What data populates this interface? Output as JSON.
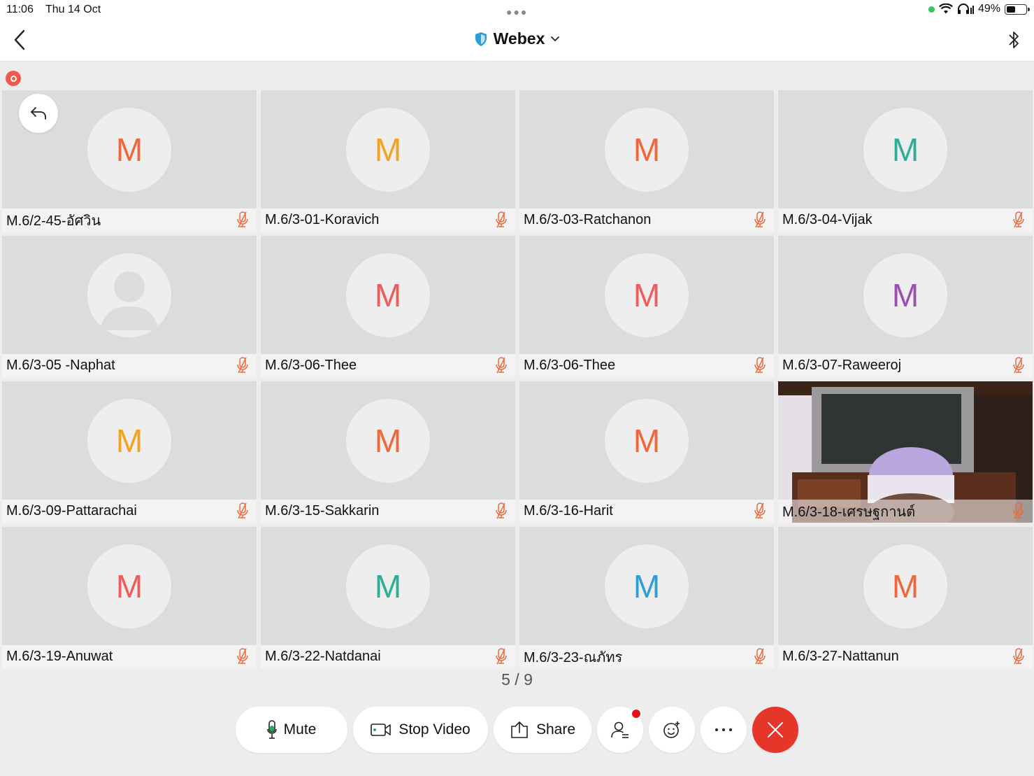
{
  "status": {
    "time": "11:06",
    "date": "Thu 14 Oct",
    "battery_text": "49%",
    "battery_level": 0.49
  },
  "header": {
    "title": "Webex"
  },
  "participants": [
    {
      "name": "M.6/2-45-อัศวิน",
      "initial": "M",
      "color": "#f0673c",
      "type": "initial"
    },
    {
      "name": "M.6/3-01-Koravich",
      "initial": "M",
      "color": "#f2a321",
      "type": "initial"
    },
    {
      "name": "M.6/3-03-Ratchanon",
      "initial": "M",
      "color": "#f0673c",
      "type": "initial"
    },
    {
      "name": "M.6/3-04-Vijak",
      "initial": "M",
      "color": "#2fae95",
      "type": "initial"
    },
    {
      "name": "M.6/3-05 -Naphat",
      "initial": "",
      "color": "#eeeeee",
      "type": "silhouette"
    },
    {
      "name": "M.6/3-06-Thee",
      "initial": "M",
      "color": "#ef5c5c",
      "type": "initial"
    },
    {
      "name": "M.6/3-06-Thee",
      "initial": "M",
      "color": "#ef5c5c",
      "type": "initial"
    },
    {
      "name": "M.6/3-07-Raweeroj",
      "initial": "M",
      "color": "#9b4fb0",
      "type": "initial"
    },
    {
      "name": "M.6/3-09-Pattarachai",
      "initial": "M",
      "color": "#f2a321",
      "type": "initial"
    },
    {
      "name": "M.6/3-15-Sakkarin",
      "initial": "M",
      "color": "#f0673c",
      "type": "initial"
    },
    {
      "name": "M.6/3-16-Harit",
      "initial": "M",
      "color": "#f0673c",
      "type": "initial"
    },
    {
      "name": "M.6/3-18-เศรษฐกานต์",
      "initial": "",
      "color": "#3a2a22",
      "type": "video"
    },
    {
      "name": "M.6/3-19-Anuwat",
      "initial": "M",
      "color": "#ef5c5c",
      "type": "initial"
    },
    {
      "name": "M.6/3-22-Natdanai",
      "initial": "M",
      "color": "#2fae95",
      "type": "initial"
    },
    {
      "name": "M.6/3-23-ณภัทร",
      "initial": "M",
      "color": "#2d9fd8",
      "type": "initial"
    },
    {
      "name": "M.6/3-27-Nattanun",
      "initial": "M",
      "color": "#f0673c",
      "type": "initial"
    }
  ],
  "pager": "5 / 9",
  "controls": {
    "mute_label": "Mute",
    "stop_video_label": "Stop Video",
    "share_label": "Share"
  },
  "colors": {
    "mic_off": "#f0673c",
    "end_call": "#e63629",
    "mic_green": "#1db05a",
    "shield": "#2d9fd8"
  }
}
